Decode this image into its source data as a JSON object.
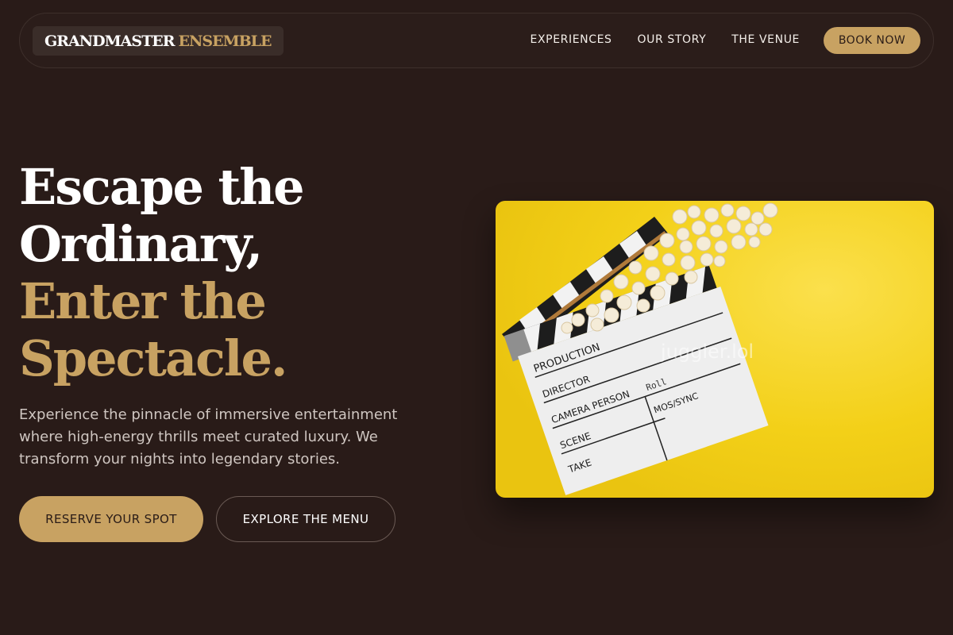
{
  "brand": {
    "name_part1": "GRANDMASTER",
    "name_part2": "ENSEMBLE"
  },
  "nav": {
    "links": [
      {
        "label": "EXPERIENCES"
      },
      {
        "label": "OUR STORY"
      },
      {
        "label": "THE VENUE"
      }
    ],
    "cta_label": "BOOK NOW"
  },
  "hero": {
    "headline": {
      "line1": "Escape the",
      "line2": "Ordinary,",
      "line3": "Enter the",
      "line4": "Spectacle."
    },
    "description": "Experience the pinnacle of immersive entertainment where high-energy thrills meet curated luxury. We transform your nights into legendary stories.",
    "primary_cta": "RESERVE YOUR SPOT",
    "secondary_cta": "EXPLORE THE MENU"
  },
  "image": {
    "slate_fields": {
      "production": "PRODUCTION",
      "director": "DIRECTOR",
      "camera": "CAMERA PERSON",
      "roll": "Roll",
      "scene": "SCENE",
      "mos": "MOS/SYNC",
      "take": "TAKE"
    },
    "watermark": "juggler.lol"
  },
  "colors": {
    "background": "#291b18",
    "accent_gold": "#c8a262",
    "text_white": "#ffffff",
    "text_muted": "#cfc6c1",
    "image_yellow": "#f4d316"
  }
}
